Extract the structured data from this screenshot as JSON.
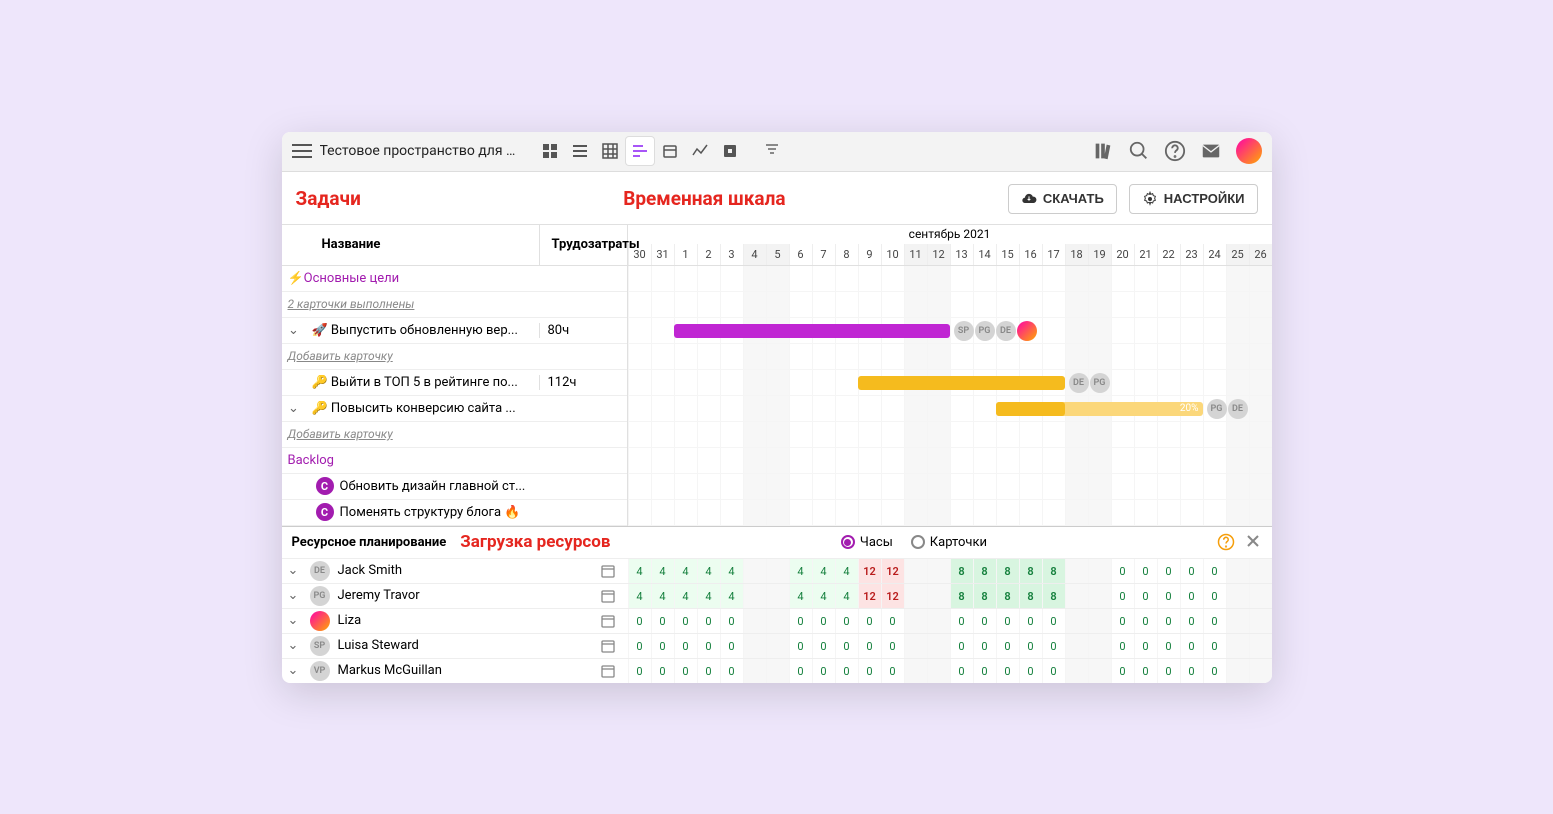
{
  "topbar": {
    "workspace_name": "Тестовое пространство для с..."
  },
  "header": {
    "tasks_label": "Задачи",
    "timeline_label": "Временная шкала",
    "download_btn": "СКАЧАТЬ",
    "settings_btn": "НАСТРОЙКИ"
  },
  "columns": {
    "name": "Название",
    "effort": "Трудозатраты"
  },
  "timeline": {
    "month_label": "сентябрь 2021",
    "days": [
      "30",
      "31",
      "1",
      "2",
      "3",
      "4",
      "5",
      "6",
      "7",
      "8",
      "9",
      "10",
      "11",
      "12",
      "13",
      "14",
      "15",
      "16",
      "17",
      "18",
      "19",
      "20",
      "21",
      "22",
      "23",
      "24",
      "25",
      "26"
    ],
    "weekend_idx": [
      5,
      6,
      12,
      13,
      19,
      20,
      26,
      27
    ]
  },
  "groups": [
    {
      "title": "⚡Основные цели",
      "title_color": "#a21caf",
      "subtext": "2 карточки выполнены",
      "tasks": [
        {
          "expand": true,
          "icon": "🚀",
          "name": "Выпустить обновленную вер...",
          "effort": "80ч",
          "bar": {
            "start": 2,
            "len": 12,
            "color": "magenta"
          },
          "assignees": [
            "SP",
            "PG",
            "DE",
            "photo"
          ],
          "add_card": true
        },
        {
          "expand": false,
          "icon": "🔑",
          "name": "Выйти в ТОП 5 в рейтинге по...",
          "effort": "112ч",
          "bar": {
            "start": 10,
            "len": 9,
            "color": "amber"
          },
          "assignees": [
            "DE",
            "PG"
          ],
          "drag": true
        },
        {
          "expand": true,
          "icon": "🔑",
          "name": "Повысить конверсию сайта ...",
          "effort": "",
          "bar": {
            "start": 16,
            "len": 9,
            "color": "amber",
            "progress": 3,
            "pct": "20%"
          },
          "assignees": [
            "PG",
            "DE"
          ],
          "add_card": true
        }
      ]
    },
    {
      "title": "Backlog",
      "title_color": "#a21caf",
      "tasks": [
        {
          "badge": "С",
          "name": "Обновить дизайн главной ст..."
        },
        {
          "badge": "С",
          "name": "Поменять структуру блога 🔥"
        }
      ]
    }
  ],
  "add_card_text": "Добавить карточку",
  "resources": {
    "header_title": "Ресурсное планирование",
    "header_red": "Загрузка ресурсов",
    "radio_hours": "Часы",
    "radio_cards": "Карточки",
    "people": [
      {
        "avatar": "DE",
        "name": "Jack Smith",
        "values": [
          "4",
          "4",
          "4",
          "4",
          "4",
          "",
          "",
          "4",
          "4",
          "4",
          "12",
          "12",
          "",
          "",
          "8",
          "8",
          "8",
          "8",
          "8",
          "",
          "",
          "0",
          "0",
          "0",
          "0",
          "0",
          "",
          ""
        ],
        "red_idx": [
          10,
          11
        ]
      },
      {
        "avatar": "PG",
        "name": "Jeremy Travor",
        "values": [
          "4",
          "4",
          "4",
          "4",
          "4",
          "",
          "",
          "4",
          "4",
          "4",
          "12",
          "12",
          "",
          "",
          "8",
          "8",
          "8",
          "8",
          "8",
          "",
          "",
          "0",
          "0",
          "0",
          "0",
          "0",
          "",
          ""
        ],
        "red_idx": [
          10,
          11
        ]
      },
      {
        "avatar": "photo",
        "name": "Liza",
        "values": [
          "0",
          "0",
          "0",
          "0",
          "0",
          "",
          "",
          "0",
          "0",
          "0",
          "0",
          "0",
          "",
          "",
          "0",
          "0",
          "0",
          "0",
          "0",
          "",
          "",
          "0",
          "0",
          "0",
          "0",
          "0",
          "",
          ""
        ]
      },
      {
        "avatar": "SP",
        "name": "Luisa Steward",
        "values": [
          "0",
          "0",
          "0",
          "0",
          "0",
          "",
          "",
          "0",
          "0",
          "0",
          "0",
          "0",
          "",
          "",
          "0",
          "0",
          "0",
          "0",
          "0",
          "",
          "",
          "0",
          "0",
          "0",
          "0",
          "0",
          "",
          ""
        ]
      },
      {
        "avatar": "VP",
        "name": "Markus McGuillan",
        "values": [
          "0",
          "0",
          "0",
          "0",
          "0",
          "",
          "",
          "0",
          "0",
          "0",
          "0",
          "0",
          "",
          "",
          "0",
          "0",
          "0",
          "0",
          "0",
          "",
          "",
          "0",
          "0",
          "0",
          "0",
          "0",
          "",
          ""
        ]
      }
    ]
  }
}
